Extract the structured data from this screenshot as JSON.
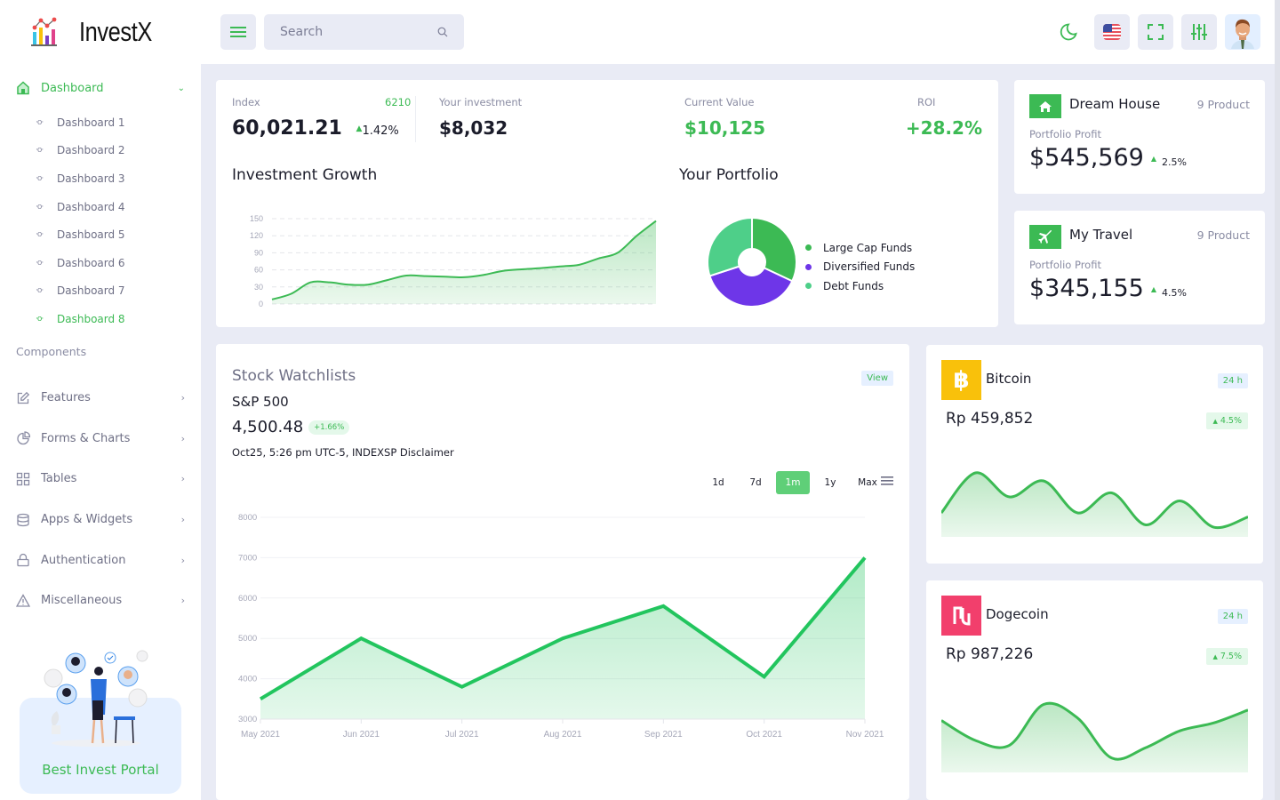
{
  "app": {
    "name": "InvestX"
  },
  "search": {
    "placeholder": "Search"
  },
  "sidebar": {
    "main": {
      "label": "Dashboard"
    },
    "sub_items": [
      {
        "label": "Dashboard 1",
        "active": false
      },
      {
        "label": "Dashboard 2",
        "active": false
      },
      {
        "label": "Dashboard 3",
        "active": false
      },
      {
        "label": "Dashboard 4",
        "active": false
      },
      {
        "label": "Dashboard 5",
        "active": false
      },
      {
        "label": "Dashboard 6",
        "active": false
      },
      {
        "label": "Dashboard 7",
        "active": false
      },
      {
        "label": "Dashboard 8",
        "active": true
      }
    ],
    "section_label": "Components",
    "components": [
      {
        "label": "Features",
        "icon": "edit-icon"
      },
      {
        "label": "Forms & Charts",
        "icon": "pie-chart-icon"
      },
      {
        "label": "Tables",
        "icon": "grid-icon"
      },
      {
        "label": "Apps & Widgets",
        "icon": "database-icon"
      },
      {
        "label": "Authentication",
        "icon": "lock-icon"
      },
      {
        "label": "Miscellaneous",
        "icon": "warning-icon"
      }
    ],
    "promo": {
      "text": "Best Invest Portal"
    }
  },
  "stats": {
    "index": {
      "label": "Index",
      "count": "6210",
      "value": "60,021.21",
      "change": "1.42%"
    },
    "investment": {
      "label": "Your investment",
      "value": "$8,032"
    },
    "current_value": {
      "label": "Current Value",
      "value": "$10,125"
    },
    "roi": {
      "label": "ROI",
      "value": "+28.2%"
    }
  },
  "investment_growth": {
    "title": "Investment Growth"
  },
  "portfolio": {
    "title": "Your Portfolio"
  },
  "goals": [
    {
      "title": "Dream House",
      "products": "9 Product",
      "sub": "Portfolio Profit",
      "value": "$545,569",
      "change": "2.5%",
      "icon": "home-icon"
    },
    {
      "title": "My Travel",
      "products": "9 Product",
      "sub": "Portfolio Profit",
      "value": "$345,155",
      "change": "4.5%",
      "icon": "plane-icon"
    }
  ],
  "watchlist": {
    "title": "Stock Watchlists",
    "view_label": "View",
    "symbol": "S&P 500",
    "price": "4,500.48",
    "change": "+1.66%",
    "meta": "Oct25, 5:26 pm UTC-5, INDEXSP Disclaimer",
    "ranges": [
      "1d",
      "7d",
      "1m",
      "1y",
      "Max"
    ],
    "active_range": "1m"
  },
  "coins": [
    {
      "name": "Bitcoin",
      "period": "24 h",
      "value": "Rp 459,852",
      "change": "4.5%",
      "color": "#f9c10b"
    },
    {
      "name": "Dogecoin",
      "period": "24 h",
      "value": "Rp 987,226",
      "change": "7.5%",
      "color": "#f23f6c"
    }
  ],
  "colors": {
    "accent": "#3cba54",
    "purple": "#6e36e8",
    "light_green": "#4ecf89"
  },
  "chart_data": [
    {
      "id": "investment-growth",
      "type": "area",
      "title": "Investment Growth",
      "x": [
        0,
        1,
        2,
        3,
        4,
        5,
        6,
        7,
        8,
        9,
        10,
        11,
        12,
        13,
        14,
        15,
        16,
        17,
        18,
        19,
        20
      ],
      "values": [
        8,
        18,
        38,
        38,
        34,
        34,
        42,
        50,
        49,
        48,
        47,
        51,
        58,
        61,
        63,
        66,
        69,
        80,
        90,
        120,
        146
      ],
      "yticks": [
        0,
        30,
        60,
        90,
        120,
        150
      ],
      "ylim": [
        0,
        150
      ],
      "grid": true
    },
    {
      "id": "portfolio",
      "type": "pie",
      "title": "Your Portfolio",
      "labels": [
        "Large Cap Funds",
        "Diversified Funds",
        "Debt Funds"
      ],
      "values": [
        32,
        38,
        30
      ],
      "colors": [
        "#3cba54",
        "#6e36e8",
        "#4ecf89"
      ],
      "legend": "right"
    },
    {
      "id": "sp500",
      "type": "area",
      "categories": [
        "May 2021",
        "Jun 2021",
        "Jul 2021",
        "Aug 2021",
        "Sep 2021",
        "Oct 2021",
        "Nov 2021"
      ],
      "values": [
        3500,
        5000,
        3800,
        5000,
        5800,
        4050,
        7000
      ],
      "yticks": [
        3000,
        4000,
        5000,
        6000,
        7000,
        8000
      ],
      "ylim": [
        3000,
        8000
      ],
      "grid": true
    },
    {
      "id": "bitcoin-spark",
      "type": "area",
      "values": [
        30,
        80,
        50,
        70,
        30,
        55,
        15,
        45,
        12,
        25
      ],
      "ylim": [
        0,
        100
      ]
    },
    {
      "id": "dogecoin-spark",
      "type": "area",
      "values": [
        65,
        40,
        34,
        85,
        68,
        18,
        31,
        52,
        62,
        78
      ],
      "ylim": [
        0,
        100
      ]
    }
  ]
}
